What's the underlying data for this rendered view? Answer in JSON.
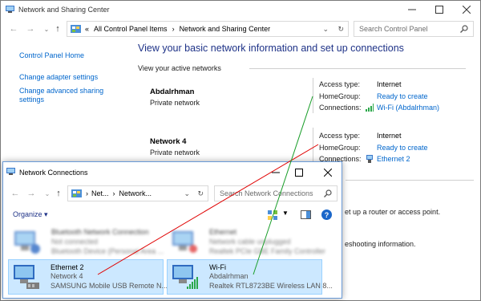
{
  "main_window": {
    "title": "Network and Sharing Center",
    "address": {
      "overflow": "«",
      "crumbs": [
        "All Control Panel Items",
        "Network and Sharing Center"
      ]
    },
    "search_placeholder": "Search Control Panel",
    "sidebar": {
      "home": "Control Panel Home",
      "adapter": "Change adapter settings",
      "sharing": "Change advanced sharing settings"
    },
    "heading": "View your basic network information and set up connections",
    "active_label": "View your active networks",
    "networks": [
      {
        "name": "Abdalrhman",
        "type": "Private network",
        "access_label": "Access type:",
        "access_value": "Internet",
        "homegroup_label": "HomeGroup:",
        "homegroup_value": "Ready to create",
        "connections_label": "Connections:",
        "connections_value": "Wi-Fi (Abdalrhman)"
      },
      {
        "name": "Network  4",
        "type": "Private network",
        "access_label": "Access type:",
        "access_value": "Internet",
        "homegroup_label": "HomeGroup:",
        "homegroup_value": "Ready to create",
        "connections_label": "Connections:",
        "connections_value": "Ethernet 2"
      }
    ],
    "background_text": {
      "router": "et up a router or access point.",
      "troubleshoot": "eshooting information."
    }
  },
  "nc_window": {
    "title": "Network Connections",
    "address": [
      "Net...",
      "Network..."
    ],
    "search_placeholder": "Search Network Connections",
    "organize": "Organize",
    "adapters": [
      {
        "name": "Bluetooth Network Connection",
        "line2": "Not connected",
        "line3": "Bluetooth Device (Personal Area ...",
        "blurred": true
      },
      {
        "name": "Ethernet",
        "line2": "Network cable unplugged",
        "line3": "Realtek PCIe GBE Family Controller",
        "blurred": true
      },
      {
        "name": "Ethernet 2",
        "line2": "Network  4",
        "line3": "SAMSUNG Mobile USB Remote N...",
        "selected": true
      },
      {
        "name": "Wi-Fi",
        "line2": "Abdalrhman",
        "line3": "Realtek RTL8723BE Wireless LAN 8...",
        "selected": true
      }
    ]
  },
  "annotation_colors": {
    "red_line": "#e00000",
    "green_line": "#1a9e2a"
  },
  "colors": {
    "link": "#0066cc",
    "heading": "#1e3287",
    "selection": "#cce8ff"
  }
}
